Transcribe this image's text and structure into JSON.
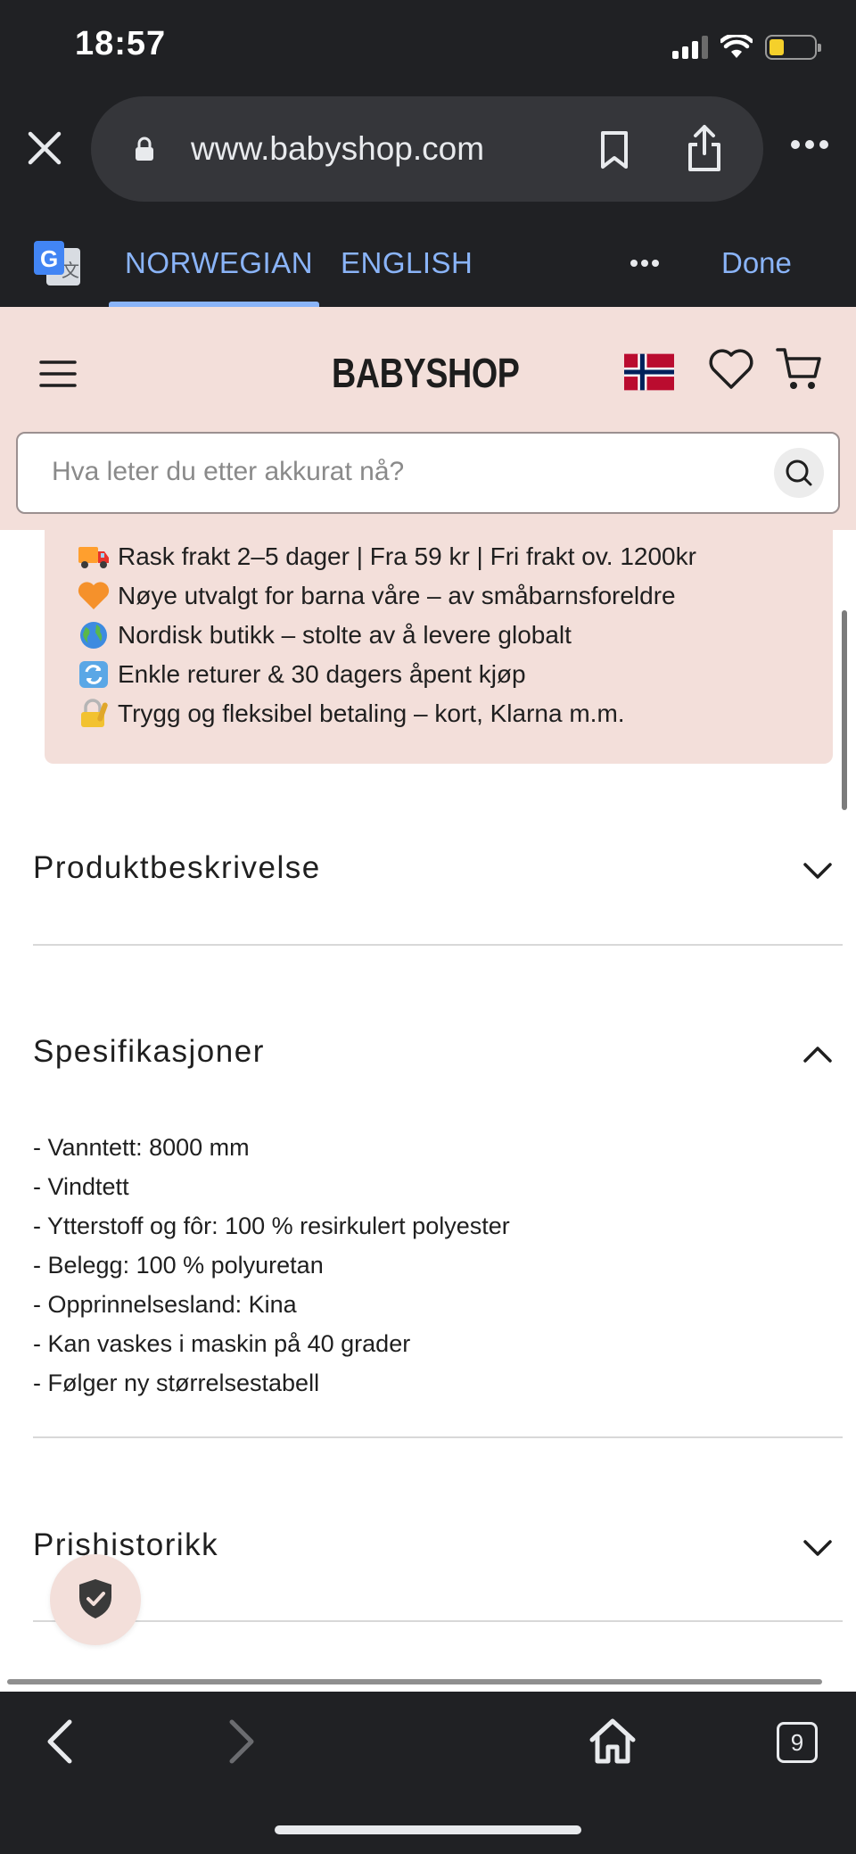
{
  "status_bar": {
    "time": "18:57"
  },
  "browser": {
    "url": "www.babyshop.com",
    "tab_count": "9"
  },
  "translate": {
    "source_lang": "NORWEGIAN",
    "target_lang": "ENGLISH",
    "done_label": "Done"
  },
  "site": {
    "brand": "BABYSHOP",
    "search_placeholder": "Hva leter du etter akkurat nå?"
  },
  "usps": [
    {
      "icon": "delivery-truck-emoji",
      "text": "Rask frakt 2–5 dager | Fra 59 kr | Fri frakt ov. 1200kr"
    },
    {
      "icon": "orange-heart-emoji",
      "text": "Nøye utvalgt for barna våre – av småbarnsforeldre"
    },
    {
      "icon": "globe-emoji",
      "text": "Nordisk butikk – stolte av å levere globalt"
    },
    {
      "icon": "arrows-cycle-emoji",
      "text": "Enkle returer & 30 dagers åpent kjøp"
    },
    {
      "icon": "lock-with-key-emoji",
      "text": "Trygg og fleksibel betaling – kort, Klarna m.m."
    }
  ],
  "accordions": {
    "description": {
      "title": "Produktbeskrivelse",
      "state": "collapsed"
    },
    "specs": {
      "title": "Spesifikasjoner",
      "state": "expanded",
      "items": [
        "- Vanntett: 8000 mm",
        "- Vindtett",
        "- Ytterstoff og fôr: 100 % resirkulert polyester",
        "- Belegg: 100 % polyuretan",
        "- Opprinnelsesland: Kina",
        "- Kan vaskes i maskin på 40 grader",
        "- Følger ny størrelsestabell"
      ]
    },
    "price_history": {
      "title": "Prishistorikk",
      "state": "collapsed"
    }
  },
  "colors": {
    "chrome_bg": "#202124",
    "url_pill": "#35363a",
    "translate_accent": "#8ab4f8",
    "site_header_bg": "#f3dfda",
    "text": "#1f1f1f"
  }
}
